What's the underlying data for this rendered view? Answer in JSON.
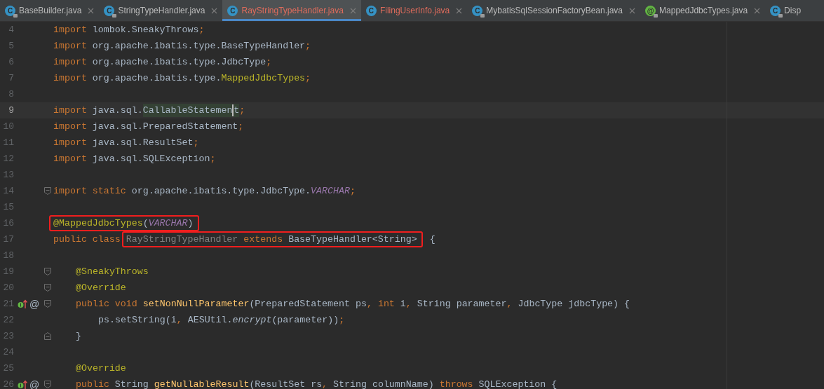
{
  "tabs": [
    {
      "label": "BaseBuilder.java",
      "kind": "class",
      "icon_letter": "C",
      "locked": true,
      "error": false,
      "selected": false,
      "closable": true
    },
    {
      "label": "StringTypeHandler.java",
      "kind": "class",
      "icon_letter": "C",
      "locked": true,
      "error": false,
      "selected": false,
      "closable": true
    },
    {
      "label": "RayStringTypeHandler.java",
      "kind": "class",
      "icon_letter": "C",
      "locked": false,
      "error": true,
      "selected": true,
      "closable": true
    },
    {
      "label": "FilingUserInfo.java",
      "kind": "class",
      "icon_letter": "C",
      "locked": false,
      "error": true,
      "selected": false,
      "closable": true
    },
    {
      "label": "MybatisSqlSessionFactoryBean.java",
      "kind": "class",
      "icon_letter": "C",
      "locked": true,
      "error": false,
      "selected": false,
      "closable": true
    },
    {
      "label": "MappedJdbcTypes.java",
      "kind": "annotation",
      "icon_letter": "@",
      "locked": true,
      "error": false,
      "selected": false,
      "closable": true
    },
    {
      "label": "Disp",
      "kind": "class",
      "icon_letter": "C",
      "locked": true,
      "error": false,
      "selected": false,
      "closable": false
    }
  ],
  "editor": {
    "lines": [
      {
        "number": "4",
        "current": false,
        "tokens": [
          {
            "kind": "keyword",
            "text": "import"
          },
          {
            "kind": "plain",
            "text": " lombok.SneakyThrows"
          },
          {
            "kind": "keyword",
            "text": ";"
          }
        ]
      },
      {
        "number": "5",
        "current": false,
        "tokens": [
          {
            "kind": "keyword",
            "text": "import"
          },
          {
            "kind": "plain",
            "text": " org.apache.ibatis.type.BaseTypeHandler"
          },
          {
            "kind": "keyword",
            "text": ";"
          }
        ]
      },
      {
        "number": "6",
        "current": false,
        "tokens": [
          {
            "kind": "keyword",
            "text": "import"
          },
          {
            "kind": "plain",
            "text": " org.apache.ibatis.type.JdbcType"
          },
          {
            "kind": "keyword",
            "text": ";"
          }
        ]
      },
      {
        "number": "7",
        "current": false,
        "tokens": [
          {
            "kind": "keyword",
            "text": "import"
          },
          {
            "kind": "plain",
            "text": " org.apache.ibatis.type."
          },
          {
            "kind": "annotation",
            "text": "MappedJdbcTypes"
          },
          {
            "kind": "keyword",
            "text": ";"
          }
        ]
      },
      {
        "number": "8",
        "current": false
      },
      {
        "number": "9",
        "current": true,
        "tokens": [
          {
            "kind": "keyword",
            "text": "import"
          },
          {
            "kind": "plain",
            "text": " java.sql."
          },
          {
            "kind": "highlighted",
            "text": "CallableStatemen"
          },
          {
            "kind": "caret"
          },
          {
            "kind": "highlighted",
            "text": "t"
          },
          {
            "kind": "keyword",
            "text": ";"
          }
        ]
      },
      {
        "number": "10",
        "current": false,
        "tokens": [
          {
            "kind": "keyword",
            "text": "import"
          },
          {
            "kind": "plain",
            "text": " java.sql.PreparedStatement"
          },
          {
            "kind": "keyword",
            "text": ";"
          }
        ]
      },
      {
        "number": "11",
        "current": false,
        "tokens": [
          {
            "kind": "keyword",
            "text": "import"
          },
          {
            "kind": "plain",
            "text": " java.sql.ResultSet"
          },
          {
            "kind": "keyword",
            "text": ";"
          }
        ]
      },
      {
        "number": "12",
        "current": false,
        "tokens": [
          {
            "kind": "keyword",
            "text": "import"
          },
          {
            "kind": "plain",
            "text": " java.sql.SQLException"
          },
          {
            "kind": "keyword",
            "text": ";"
          }
        ]
      },
      {
        "number": "13",
        "current": false
      },
      {
        "number": "14",
        "current": false,
        "fold": {
          "kind": "start"
        },
        "tokens": [
          {
            "kind": "keyword",
            "text": "import static"
          },
          {
            "kind": "plain",
            "text": " org.apache.ibatis.type.JdbcType."
          },
          {
            "kind": "constant",
            "text": "VARCHAR"
          },
          {
            "kind": "keyword",
            "text": ";"
          }
        ]
      },
      {
        "number": "15",
        "current": false
      },
      {
        "number": "16",
        "current": false,
        "tokens": [
          {
            "kind": "annotation",
            "text": "@MappedJdbcTypes",
            "boxed": true
          },
          {
            "kind": "plain",
            "text": "(",
            "boxed": true
          },
          {
            "kind": "constant",
            "text": "VARCHAR",
            "boxed": true
          },
          {
            "kind": "plain",
            "text": ")",
            "boxed": true
          }
        ]
      },
      {
        "number": "17",
        "current": false,
        "tokens": [
          {
            "kind": "keyword",
            "text": "public class "
          },
          {
            "kind": "unused",
            "text": "RayStringTypeHandler",
            "boxed": true
          },
          {
            "kind": "keyword",
            "text": " extends ",
            "boxed": true
          },
          {
            "kind": "plain",
            "text": "BaseTypeHandler<String>",
            "boxed": true
          },
          {
            "kind": "plain",
            "text": " {"
          }
        ]
      },
      {
        "number": "18",
        "current": false
      },
      {
        "number": "19",
        "current": false,
        "fold": {
          "kind": "start"
        },
        "tokens": [
          {
            "kind": "indent"
          },
          {
            "kind": "annotation",
            "text": "@SneakyThrows"
          }
        ]
      },
      {
        "number": "20",
        "current": false,
        "fold": {
          "kind": "start"
        },
        "tokens": [
          {
            "kind": "indent"
          },
          {
            "kind": "annotation",
            "text": "@Override"
          }
        ]
      },
      {
        "number": "21",
        "current": false,
        "fold": {
          "kind": "start"
        },
        "marker": {
          "kind": "override",
          "symbol": "@"
        },
        "tokens": [
          {
            "kind": "indent"
          },
          {
            "kind": "keyword",
            "text": "public void "
          },
          {
            "kind": "method",
            "text": "setNonNullParameter"
          },
          {
            "kind": "plain",
            "text": "(PreparedStatement ps"
          },
          {
            "kind": "keyword",
            "text": ", int "
          },
          {
            "kind": "plain",
            "text": "i"
          },
          {
            "kind": "keyword",
            "text": ", "
          },
          {
            "kind": "plain",
            "text": "String parameter"
          },
          {
            "kind": "keyword",
            "text": ", "
          },
          {
            "kind": "plain",
            "text": "JdbcType jdbcType) {"
          }
        ]
      },
      {
        "number": "22",
        "current": false,
        "tokens": [
          {
            "kind": "indent"
          },
          {
            "kind": "indent"
          },
          {
            "kind": "plain",
            "text": "ps.setString(i"
          },
          {
            "kind": "keyword",
            "text": ", "
          },
          {
            "kind": "plain",
            "text": "AESUtil."
          },
          {
            "kind": "static",
            "text": "encrypt"
          },
          {
            "kind": "plain",
            "text": "(parameter))"
          },
          {
            "kind": "keyword",
            "text": ";"
          }
        ]
      },
      {
        "number": "23",
        "current": false,
        "fold": {
          "kind": "end"
        },
        "tokens": [
          {
            "kind": "indent"
          },
          {
            "kind": "plain",
            "text": "}"
          }
        ]
      },
      {
        "number": "24",
        "current": false
      },
      {
        "number": "25",
        "current": false,
        "tokens": [
          {
            "kind": "indent"
          },
          {
            "kind": "annotation",
            "text": "@Override"
          }
        ]
      },
      {
        "number": "26",
        "current": false,
        "fold": {
          "kind": "start"
        },
        "marker": {
          "kind": "override",
          "symbol": "@"
        },
        "tokens": [
          {
            "kind": "indent"
          },
          {
            "kind": "keyword",
            "text": "public "
          },
          {
            "kind": "plain",
            "text": "String "
          },
          {
            "kind": "method",
            "text": "getNullableResult"
          },
          {
            "kind": "plain",
            "text": "(ResultSet rs"
          },
          {
            "kind": "keyword",
            "text": ", "
          },
          {
            "kind": "plain",
            "text": "String columnName) "
          },
          {
            "kind": "keyword",
            "text": "throws "
          },
          {
            "kind": "plain",
            "text": "SQLException {"
          }
        ]
      }
    ]
  }
}
